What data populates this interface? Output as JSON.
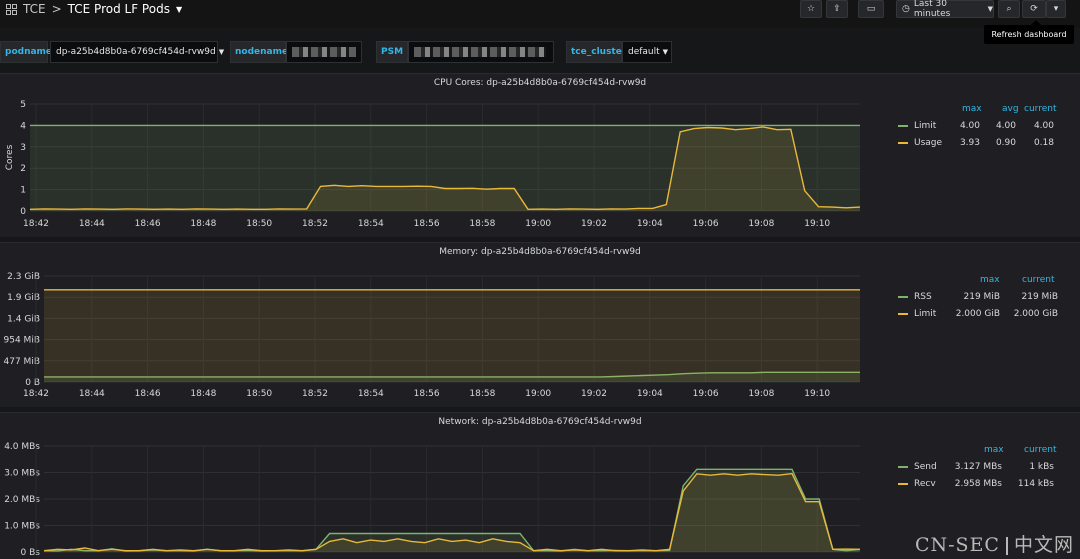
{
  "header": {
    "breadcrumb_home": "TCE",
    "breadcrumb_sep": ">",
    "dashboard_title": "TCE Prod LF Pods",
    "time_range": "Last 30 minutes",
    "tooltip": "Refresh dashboard"
  },
  "variables": {
    "podname_label": "podname",
    "podname_value": "dp-a25b4d8b0a-6769cf454d-rvw9d",
    "nodename_label": "nodename",
    "psm_label": "PSM",
    "cluster_label": "tce_cluster",
    "cluster_value": "default"
  },
  "colors": {
    "green": "#7eb26d",
    "yellow": "#eab839",
    "accent": "#33b5e5"
  },
  "time_ticks": [
    "18:42",
    "18:44",
    "18:46",
    "18:48",
    "18:50",
    "18:52",
    "18:54",
    "18:56",
    "18:58",
    "19:00",
    "19:02",
    "19:04",
    "19:06",
    "19:08",
    "19:10"
  ],
  "watermark": "CN-SEC",
  "watermark_cn": "中文网",
  "chart_data": [
    {
      "type": "line",
      "title": "CPU Cores: dp-a25b4d8b0a-6769cf454d-rvw9d",
      "ylabel": "Cores",
      "yticks": [
        "0",
        "1",
        "2",
        "3",
        "4",
        "5"
      ],
      "ylim": [
        0,
        5
      ],
      "x": [
        0,
        1,
        2,
        3,
        4,
        5,
        6,
        7,
        8,
        9,
        10,
        11,
        12,
        13,
        14,
        15,
        16,
        17,
        18,
        19,
        20,
        21,
        22,
        23,
        24,
        25,
        26,
        27,
        28,
        29,
        30,
        31,
        32,
        33,
        34,
        35,
        36,
        37,
        38,
        39,
        40,
        41,
        42,
        43,
        44,
        45,
        46,
        47,
        48,
        49,
        50,
        51,
        52,
        53,
        54,
        55,
        56,
        57,
        58,
        59,
        60
      ],
      "series": [
        {
          "name": "Limit",
          "color": "#7eb26d",
          "values": [
            4,
            4,
            4,
            4,
            4,
            4,
            4,
            4,
            4,
            4,
            4,
            4,
            4,
            4,
            4,
            4,
            4,
            4,
            4,
            4,
            4,
            4,
            4,
            4,
            4,
            4,
            4,
            4,
            4,
            4,
            4,
            4,
            4,
            4,
            4,
            4,
            4,
            4,
            4,
            4,
            4,
            4,
            4,
            4,
            4,
            4,
            4,
            4,
            4,
            4,
            4,
            4,
            4,
            4,
            4,
            4,
            4,
            4,
            4,
            4,
            4
          ]
        },
        {
          "name": "Usage",
          "color": "#eab839",
          "values": [
            0.08,
            0.1,
            0.09,
            0.08,
            0.1,
            0.09,
            0.08,
            0.1,
            0.09,
            0.08,
            0.09,
            0.08,
            0.1,
            0.09,
            0.08,
            0.09,
            0.08,
            0.08,
            0.1,
            0.09,
            0.1,
            1.15,
            1.2,
            1.15,
            1.18,
            1.15,
            1.15,
            1.15,
            1.16,
            1.15,
            1.05,
            1.05,
            1.06,
            1.02,
            1.05,
            1.05,
            0.08,
            0.09,
            0.08,
            0.1,
            0.09,
            0.08,
            0.1,
            0.09,
            0.12,
            0.12,
            0.3,
            3.7,
            3.85,
            3.9,
            3.88,
            3.8,
            3.85,
            3.93,
            3.8,
            3.82,
            0.95,
            0.2,
            0.18,
            0.15,
            0.18
          ]
        }
      ],
      "legend": {
        "headers": [
          "max",
          "avg",
          "current"
        ],
        "rows": [
          [
            "4.00",
            "4.00",
            "4.00"
          ],
          [
            "3.93",
            "0.90",
            "0.18"
          ]
        ]
      }
    },
    {
      "type": "line",
      "title": "Memory: dp-a25b4d8b0a-6769cf454d-rvw9d",
      "ylabel": "",
      "yticks": [
        "0 B",
        "477 MiB",
        "954 MiB",
        "1.4 GiB",
        "1.9 GiB",
        "2.3 GiB"
      ],
      "ylim": [
        0,
        2.3
      ],
      "x": [
        0,
        1,
        2,
        3,
        4,
        5,
        6,
        7,
        8,
        9,
        10,
        11,
        12,
        13,
        14,
        15,
        16,
        17,
        18,
        19,
        20,
        21,
        22,
        23,
        24,
        25,
        26,
        27,
        28,
        29,
        30,
        31,
        32,
        33,
        34,
        35,
        36,
        37,
        38,
        39,
        40,
        41,
        42,
        43,
        44,
        45,
        46,
        47,
        48,
        49,
        50,
        51,
        52,
        53,
        54,
        55,
        56,
        57,
        58,
        59,
        60
      ],
      "series": [
        {
          "name": "RSS",
          "color": "#7eb26d",
          "values": [
            0.11,
            0.11,
            0.11,
            0.11,
            0.11,
            0.11,
            0.11,
            0.11,
            0.11,
            0.11,
            0.11,
            0.11,
            0.11,
            0.11,
            0.11,
            0.11,
            0.11,
            0.11,
            0.11,
            0.11,
            0.11,
            0.11,
            0.11,
            0.11,
            0.11,
            0.11,
            0.11,
            0.11,
            0.11,
            0.11,
            0.11,
            0.11,
            0.11,
            0.11,
            0.11,
            0.11,
            0.11,
            0.11,
            0.11,
            0.11,
            0.11,
            0.11,
            0.12,
            0.13,
            0.14,
            0.15,
            0.16,
            0.18,
            0.19,
            0.2,
            0.2,
            0.2,
            0.2,
            0.21,
            0.21,
            0.21,
            0.21,
            0.21,
            0.21,
            0.21,
            0.21
          ]
        },
        {
          "name": "Limit",
          "color": "#eab839",
          "values": [
            2,
            2,
            2,
            2,
            2,
            2,
            2,
            2,
            2,
            2,
            2,
            2,
            2,
            2,
            2,
            2,
            2,
            2,
            2,
            2,
            2,
            2,
            2,
            2,
            2,
            2,
            2,
            2,
            2,
            2,
            2,
            2,
            2,
            2,
            2,
            2,
            2,
            2,
            2,
            2,
            2,
            2,
            2,
            2,
            2,
            2,
            2,
            2,
            2,
            2,
            2,
            2,
            2,
            2,
            2,
            2,
            2,
            2,
            2,
            2,
            2
          ]
        }
      ],
      "legend": {
        "headers": [
          "max",
          "current"
        ],
        "rows": [
          [
            "219 MiB",
            "219 MiB"
          ],
          [
            "2.000 GiB",
            "2.000 GiB"
          ]
        ]
      }
    },
    {
      "type": "line",
      "title": "Network: dp-a25b4d8b0a-6769cf454d-rvw9d",
      "ylabel": "",
      "yticks": [
        "0 Bs",
        "1.0 MBs",
        "2.0 MBs",
        "3.0 MBs",
        "4.0 MBs"
      ],
      "ylim": [
        0,
        4
      ],
      "x": [
        0,
        1,
        2,
        3,
        4,
        5,
        6,
        7,
        8,
        9,
        10,
        11,
        12,
        13,
        14,
        15,
        16,
        17,
        18,
        19,
        20,
        21,
        22,
        23,
        24,
        25,
        26,
        27,
        28,
        29,
        30,
        31,
        32,
        33,
        34,
        35,
        36,
        37,
        38,
        39,
        40,
        41,
        42,
        43,
        44,
        45,
        46,
        47,
        48,
        49,
        50,
        51,
        52,
        53,
        54,
        55,
        56,
        57,
        58,
        59,
        60
      ],
      "series": [
        {
          "name": "Send",
          "color": "#7eb26d",
          "values": [
            0.05,
            0.04,
            0.1,
            0.05,
            0.05,
            0.12,
            0.04,
            0.05,
            0.08,
            0.05,
            0.05,
            0.04,
            0.1,
            0.05,
            0.05,
            0.06,
            0.04,
            0.05,
            0.05,
            0.05,
            0.1,
            0.7,
            0.7,
            0.7,
            0.7,
            0.7,
            0.7,
            0.7,
            0.7,
            0.7,
            0.7,
            0.7,
            0.7,
            0.7,
            0.7,
            0.7,
            0.05,
            0.05,
            0.04,
            0.1,
            0.05,
            0.05,
            0.06,
            0.05,
            0.05,
            0.05,
            0.06,
            2.5,
            3.12,
            3.12,
            3.12,
            3.12,
            3.12,
            3.12,
            3.12,
            3.12,
            2.0,
            2.0,
            0.1,
            0.05,
            0.1
          ]
        },
        {
          "name": "Recv",
          "color": "#eab839",
          "values": [
            0.05,
            0.1,
            0.08,
            0.15,
            0.05,
            0.1,
            0.05,
            0.05,
            0.1,
            0.05,
            0.08,
            0.05,
            0.1,
            0.05,
            0.05,
            0.1,
            0.05,
            0.05,
            0.08,
            0.05,
            0.1,
            0.4,
            0.5,
            0.35,
            0.45,
            0.4,
            0.5,
            0.4,
            0.35,
            0.5,
            0.4,
            0.45,
            0.35,
            0.5,
            0.4,
            0.35,
            0.05,
            0.1,
            0.05,
            0.08,
            0.05,
            0.1,
            0.05,
            0.05,
            0.08,
            0.05,
            0.1,
            2.3,
            2.95,
            2.9,
            2.95,
            2.9,
            2.95,
            2.92,
            2.9,
            2.958,
            1.9,
            1.9,
            0.1,
            0.11,
            0.1
          ]
        }
      ],
      "legend": {
        "headers": [
          "max",
          "current"
        ],
        "rows": [
          [
            "3.127 MBs",
            "1 kBs"
          ],
          [
            "2.958 MBs",
            "114 kBs"
          ]
        ]
      }
    }
  ]
}
